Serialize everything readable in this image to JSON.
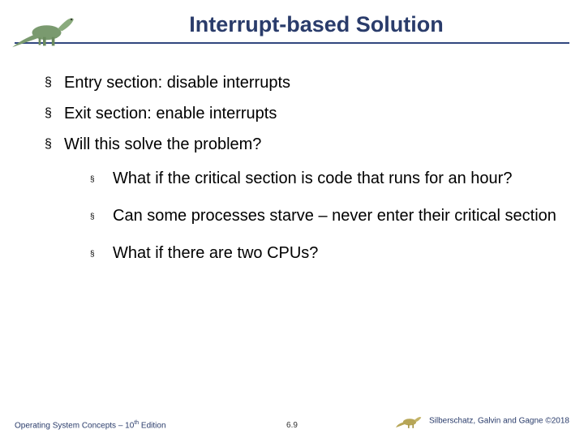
{
  "title": "Interrupt-based Solution",
  "bullets": {
    "b1": "Entry section:  disable interrupts",
    "b2": "Exit section:  enable interrupts",
    "b3": "Will this solve the problem?",
    "sub1": "What if the critical section is code that runs for an hour?",
    "sub2": "Can some processes starve – never enter their critical section",
    "sub3": "What if there are two CPUs?"
  },
  "footer": {
    "left_a": "Operating System Concepts – 10",
    "left_sup": "th",
    "left_b": " Edition",
    "center": "6.9",
    "right_a": "Silberschatz, Galvin and Gagne ",
    "right_b": "©2018"
  }
}
